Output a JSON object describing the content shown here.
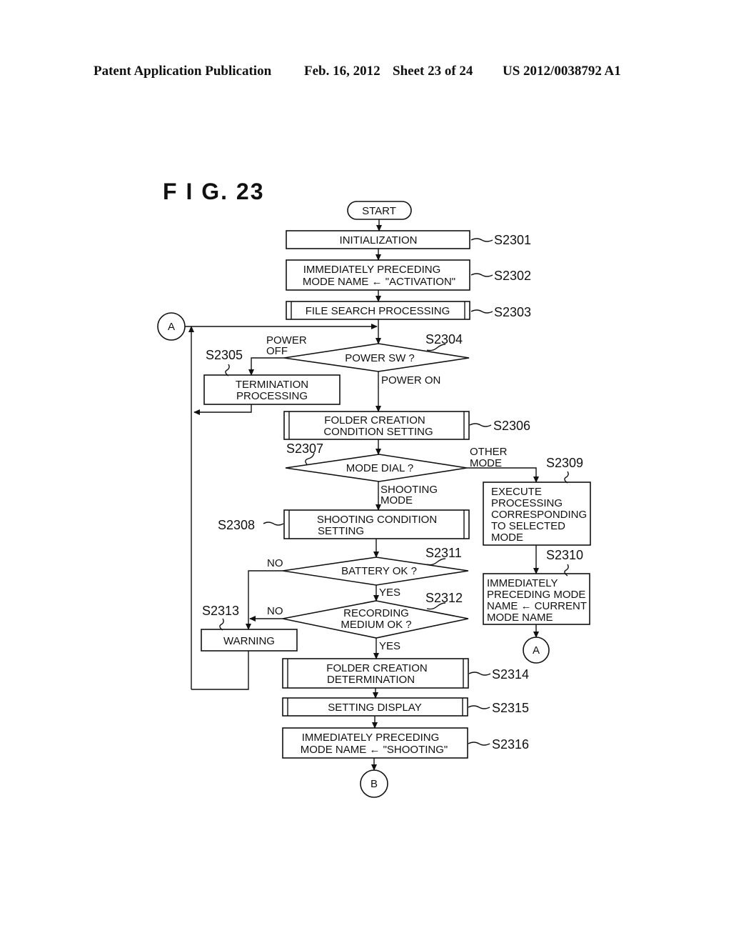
{
  "header": {
    "publication": "Patent Application Publication",
    "date": "Feb. 16, 2012",
    "sheet": "Sheet 23 of 24",
    "number": "US 2012/0038792 A1"
  },
  "figure": {
    "title": "F I G.  23"
  },
  "nodes": {
    "start": {
      "text": "START"
    },
    "s2301": {
      "step": "S2301",
      "lines": [
        "INITIALIZATION"
      ]
    },
    "s2302": {
      "step": "S2302",
      "lines": [
        "IMMEDIATELY  PRECEDING",
        "MODE  NAME ← \"ACTIVATION\""
      ]
    },
    "s2303": {
      "step": "S2303",
      "lines": [
        "FILE  SEARCH  PROCESSING"
      ]
    },
    "s2304": {
      "step": "S2304",
      "lines": [
        "POWER  SW ?"
      ]
    },
    "s2305": {
      "step": "S2305",
      "lines": [
        "TERMINATION",
        "PROCESSING"
      ]
    },
    "s2306": {
      "step": "S2306",
      "lines": [
        "FOLDER  CREATION",
        "CONDITION  SETTING"
      ]
    },
    "s2307": {
      "step": "S2307",
      "lines": [
        "MODE  DIAL ?"
      ]
    },
    "s2308": {
      "step": "S2308",
      "lines": [
        "SHOOTING  CONDITION",
        "SETTING"
      ]
    },
    "s2309": {
      "step": "S2309",
      "lines": [
        "EXECUTE",
        "PROCESSING",
        "CORRESPONDING",
        "TO  SELECTED",
        "MODE"
      ]
    },
    "s2310": {
      "step": "S2310",
      "lines": [
        "IMMEDIATELY",
        "PRECEDING  MODE",
        "NAME ← CURRENT",
        "MODE  NAME"
      ]
    },
    "s2311": {
      "step": "S2311",
      "lines": [
        "BATTERY  OK ?"
      ]
    },
    "s2312": {
      "step": "S2312",
      "lines": [
        "RECORDING",
        "MEDIUM  OK ?"
      ]
    },
    "s2313": {
      "step": "S2313",
      "lines": [
        "WARNING"
      ]
    },
    "s2314": {
      "step": "S2314",
      "lines": [
        "FOLDER  CREATION",
        "DETERMINATION"
      ]
    },
    "s2315": {
      "step": "S2315",
      "lines": [
        "SETTING  DISPLAY"
      ]
    },
    "s2316": {
      "step": "S2316",
      "lines": [
        "IMMEDIATELY  PRECEDING",
        "MODE  NAME ← \"SHOOTING\""
      ]
    }
  },
  "connectors": {
    "a_left": "A",
    "a_right": "A",
    "b_bottom": "B"
  },
  "edge_labels": {
    "power_off": [
      "POWER",
      "OFF"
    ],
    "power_on": "POWER  ON",
    "other_mode": [
      "OTHER",
      "MODE"
    ],
    "shooting_mode": [
      "SHOOTING",
      "MODE"
    ],
    "battery_no": "NO",
    "battery_yes": "YES",
    "medium_no": "NO",
    "medium_yes": "YES"
  }
}
